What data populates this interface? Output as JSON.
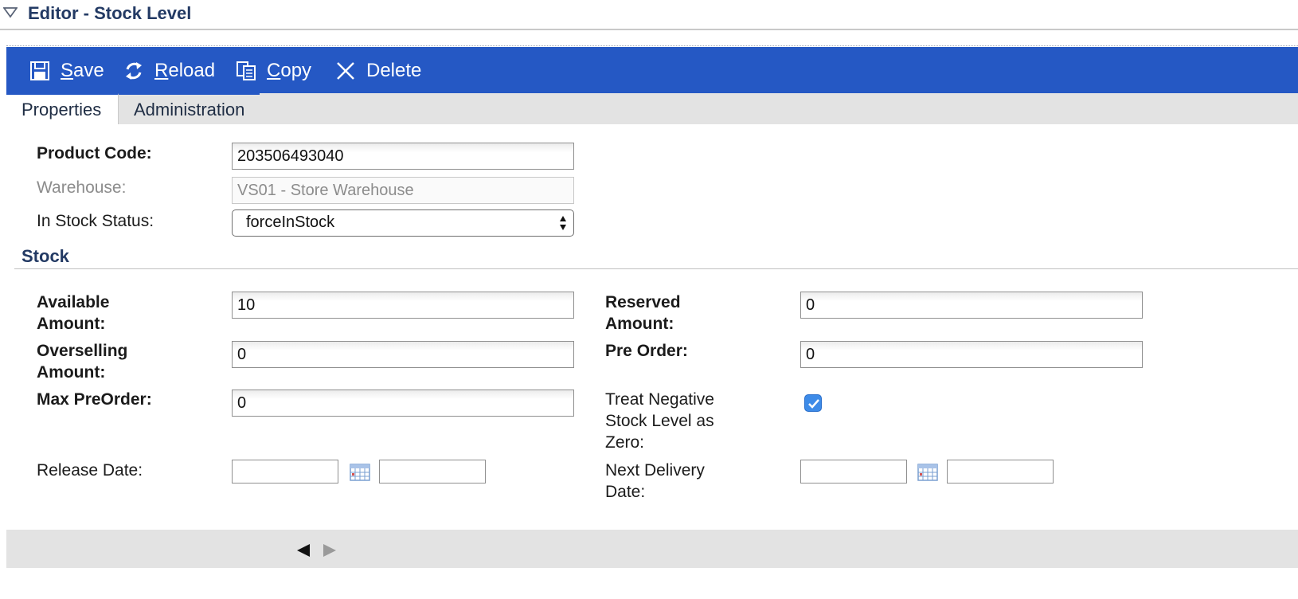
{
  "editor": {
    "title": "Editor - Stock Level"
  },
  "toolbar": {
    "save": {
      "first": "S",
      "rest": "ave",
      "icon": "floppy-disk-icon"
    },
    "reload": {
      "first": "R",
      "rest": "eload",
      "icon": "reload-icon"
    },
    "copy": {
      "first": "C",
      "rest": "opy",
      "icon": "copy-icon"
    },
    "delete": {
      "label": "Delete",
      "icon": "close-icon"
    },
    "color": "#2558c4"
  },
  "tabs": [
    {
      "label": "Properties",
      "active": true
    },
    {
      "label": "Administration",
      "active": false
    }
  ],
  "properties": {
    "product_code": {
      "label": "Product Code:",
      "value": "203506493040"
    },
    "warehouse": {
      "label": "Warehouse:",
      "value": "VS01 - Store Warehouse"
    },
    "in_stock_status": {
      "label": "In Stock Status:",
      "value": "forceInStock"
    }
  },
  "stock": {
    "section_title": "Stock",
    "available_amount": {
      "label_line1": "Available",
      "label_line2": "Amount:",
      "value": "10"
    },
    "overselling_amount": {
      "label_line1": "Overselling",
      "label_line2": "Amount:",
      "value": "0"
    },
    "max_preorder": {
      "label": "Max PreOrder:",
      "value": "0"
    },
    "release_date": {
      "label": "Release Date:",
      "date": "",
      "time": ""
    },
    "reserved_amount": {
      "label_line1": "Reserved",
      "label_line2": "Amount:",
      "value": "0"
    },
    "pre_order": {
      "label": "Pre Order:",
      "value": "0"
    },
    "treat_negative": {
      "label_line1": "Treat Negative",
      "label_line2": "Stock Level as",
      "label_line3": "Zero:",
      "checked": true
    },
    "next_delivery_date": {
      "label_line1": "Next Delivery",
      "label_line2": "Date:",
      "date": "",
      "time": ""
    }
  },
  "footer": {
    "prev_icon": "arrow-left-icon",
    "next_icon": "arrow-right-icon"
  }
}
